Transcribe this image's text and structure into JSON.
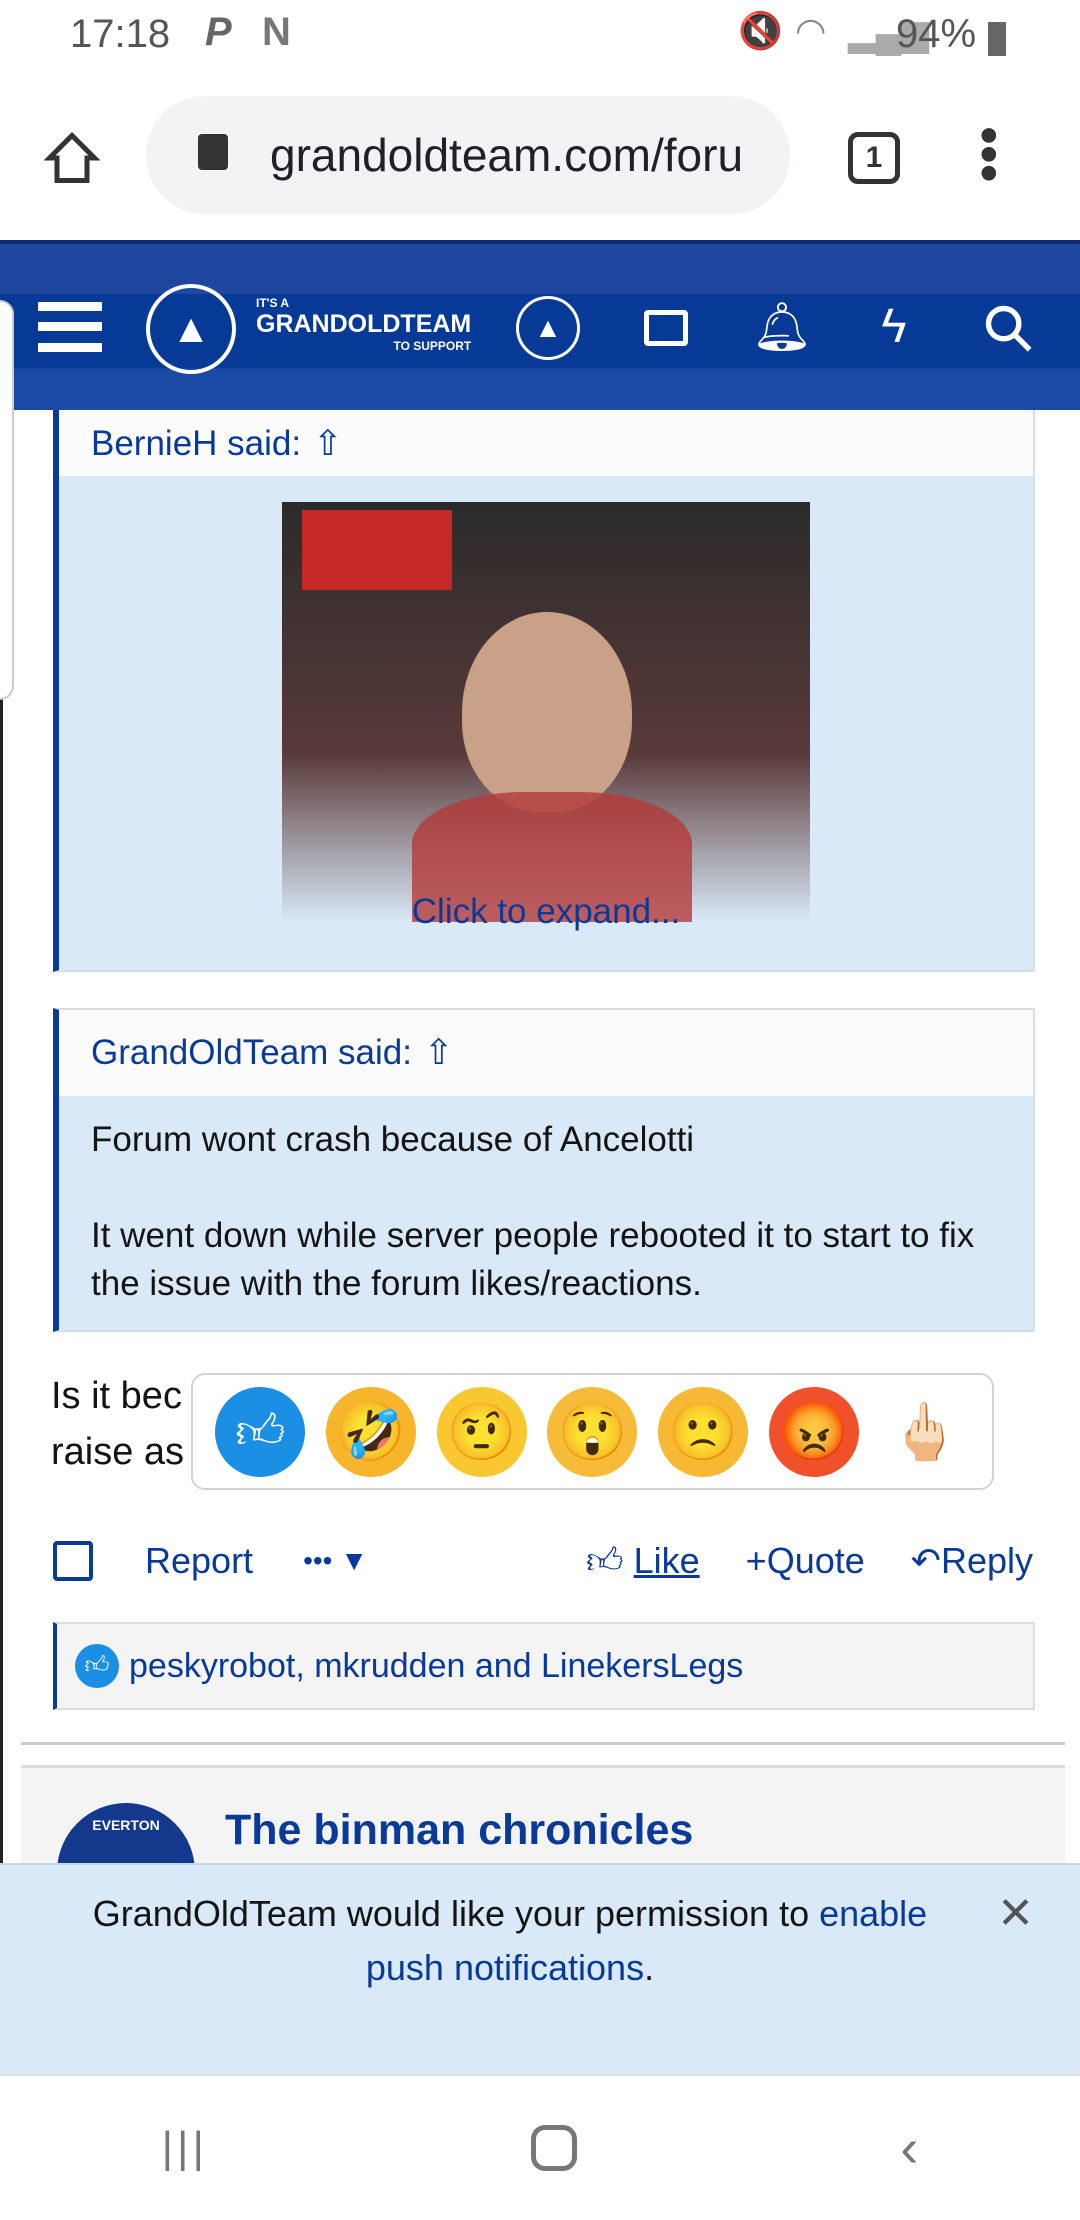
{
  "status_bar": {
    "time": "17:18",
    "notification_icons": [
      "paypal-icon",
      "n-icon"
    ],
    "battery": "94%"
  },
  "browser": {
    "url": "grandoldteam.com/foru",
    "tab_count": "1"
  },
  "site_header": {
    "logo_top": "IT'S A",
    "logo_main": "GRANDOLDTEAM",
    "logo_bottom": "TO SUPPORT"
  },
  "quotes": [
    {
      "author": "BernieH said:",
      "expand": "Click to expand..."
    },
    {
      "author": "GrandOldTeam said:",
      "lines": [
        "Forum wont crash because of Ancelotti",
        "It went down while server people rebooted it to start to fix the issue with the forum likes/reactions."
      ]
    }
  ],
  "post": {
    "text_line1": "Is it bec",
    "text_line2": "raise as"
  },
  "reactions": [
    "like",
    "laugh",
    "suspicious",
    "shocked",
    "sad",
    "angry",
    "middle-finger"
  ],
  "actions": {
    "report": "Report",
    "more": "•••",
    "like": "Like",
    "quote": "Quote",
    "reply": "Reply"
  },
  "likes_bar": {
    "text": "peskyrobot, mkrudden and LinekersLegs"
  },
  "next_thread": {
    "title": "The binman chronicles",
    "avatar_text": "EVERTON"
  },
  "push_banner": {
    "text": "GrandOldTeam would like your permission to ",
    "link": "enable push notifications",
    "end": "."
  },
  "colors": {
    "brand": "#0a3a97",
    "quote_bg": "#d9e9f7"
  }
}
